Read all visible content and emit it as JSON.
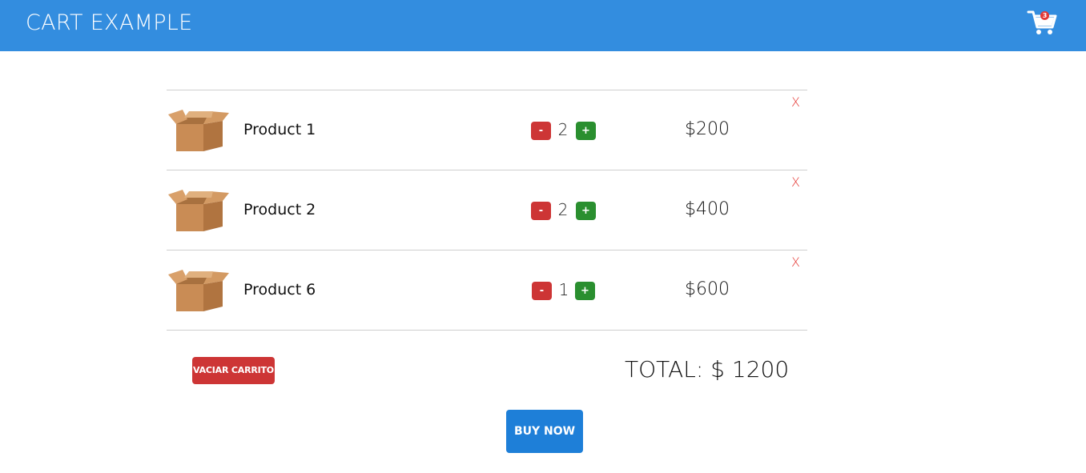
{
  "app": {
    "title": "CART EXAMPLE"
  },
  "header": {
    "cart_count": "3",
    "cart_icon": "shopping-cart-icon"
  },
  "cart": {
    "items": [
      {
        "name": "Product 1",
        "minus": "-",
        "qty": "2",
        "plus": "+",
        "price": "$200",
        "remove": "X"
      },
      {
        "name": "Product 2",
        "minus": "-",
        "qty": "2",
        "plus": "+",
        "price": "$400",
        "remove": "X"
      },
      {
        "name": "Product 6",
        "minus": "-",
        "qty": "1",
        "plus": "+",
        "price": "$600",
        "remove": "X"
      }
    ],
    "empty_label": "VACIAR CARRITO",
    "total_label": "TOTAL: $ 1200",
    "buy_label": "BUY NOW"
  },
  "colors": {
    "header": "#338ddf",
    "danger": "#cd3535",
    "success": "#2a8f2f",
    "primary": "#1e7fd8"
  }
}
